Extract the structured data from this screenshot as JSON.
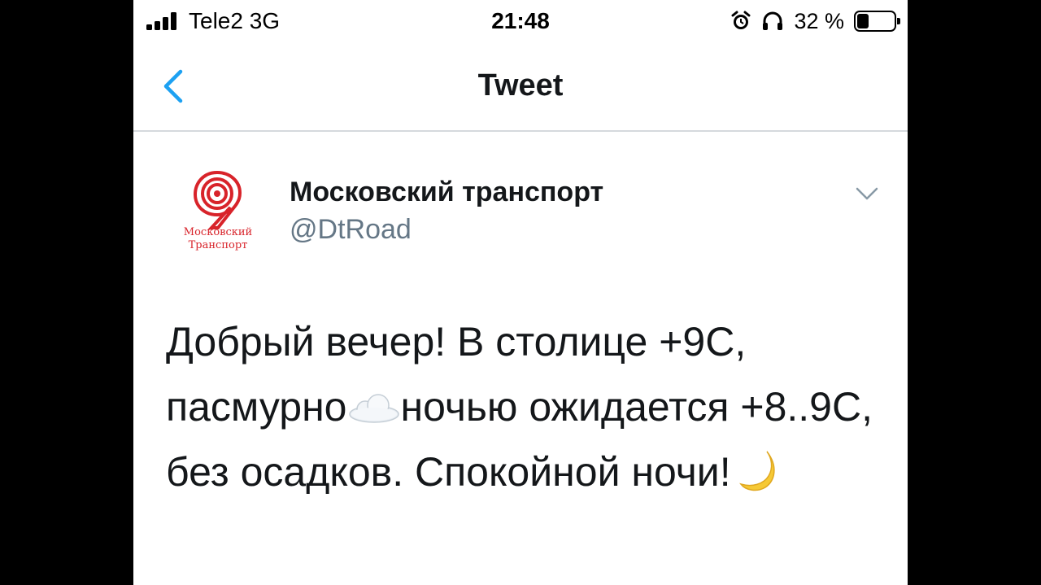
{
  "status_bar": {
    "carrier": "Tele2  3G",
    "time": "21:48",
    "battery_percent_label": "32 %",
    "battery_level": 0.32,
    "icons": [
      "signal-icon",
      "alarm-icon",
      "headphones-icon",
      "battery-icon"
    ]
  },
  "nav": {
    "title": "Tweet",
    "back_icon": "chevron-left-icon"
  },
  "tweet": {
    "author": {
      "display_name": "Московский транспорт",
      "handle": "@DtRoad",
      "avatar_text_line1": "Московский",
      "avatar_text_line2": "Транспорт"
    },
    "text_part1": "Добрый вечер! В столице +9С, пасмурно",
    "emoji1": "cloud",
    "text_part2": "ночью ожидается +8..9С, без осадков. Спокойной ночи!",
    "emoji2": "crescent-moon"
  },
  "colors": {
    "accent": "#1da1f2",
    "brand_red": "#d8232a",
    "text": "#14171a",
    "secondary_text": "#657786",
    "divider": "#d5d9dd"
  }
}
